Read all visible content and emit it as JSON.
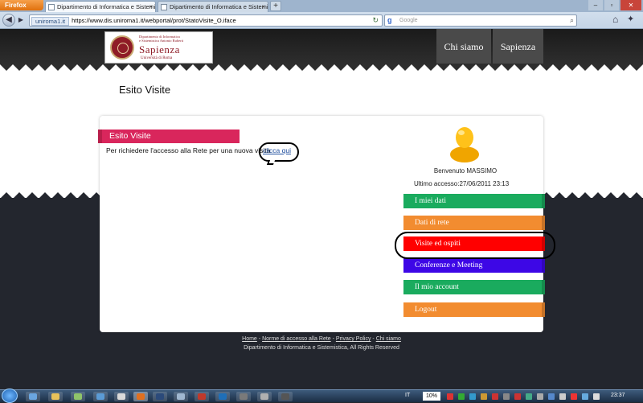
{
  "browser": {
    "app_button": "Firefox",
    "tabs": [
      {
        "label": "Dipartimento di Informatica e Sistemiti..."
      },
      {
        "label": "Dipartimento di Informatica e Sistemisti..."
      }
    ],
    "new_tab": "+",
    "site_identity": "uniroma1.it",
    "url": "https://www.dis.uniroma1.it/webportal/prot/StatoVisite_O.iface",
    "search_placeholder": "Google"
  },
  "site": {
    "logo": {
      "dept_line1": "Dipartimento di Informatica",
      "dept_line2": "e Sistemistica Antonio Ruberti",
      "name": "Sapienza",
      "university": "Università di Roma"
    },
    "nav": [
      "Chi siamo",
      "Sapienza"
    ]
  },
  "page": {
    "title": "Esito Visite",
    "section_title": "Esito Visite",
    "request_text": "Per richiedere l'accesso alla Rete per una nuova visita",
    "request_link": "clicca qui"
  },
  "user": {
    "welcome": "Benvenuto MASSIMO",
    "last_access": "Ultimo accesso:27/06/2011 23:13"
  },
  "menu": [
    {
      "label": "I miei dati",
      "color": "#1aab5e"
    },
    {
      "label": "Dati di rete",
      "color": "#f28c30"
    },
    {
      "label": "Visite ed ospiti",
      "color": "#ff0000"
    },
    {
      "label": "Conferenze e Meeting",
      "color": "#3d07e6"
    },
    {
      "label": "Il mio account",
      "color": "#1aab5e"
    },
    {
      "label": "Logout",
      "color": "#f28c30"
    }
  ],
  "footer": {
    "links": [
      "Home",
      "Norme di accesso alla Rete",
      "Privacy Policy",
      "Chi siamo"
    ],
    "separator": " - ",
    "copyright": "Dipartimento di Informatica e Sistemistica, All Rights Reserved"
  },
  "taskbar": {
    "lang": "IT",
    "zoom": "10%",
    "clock": "23:37"
  }
}
